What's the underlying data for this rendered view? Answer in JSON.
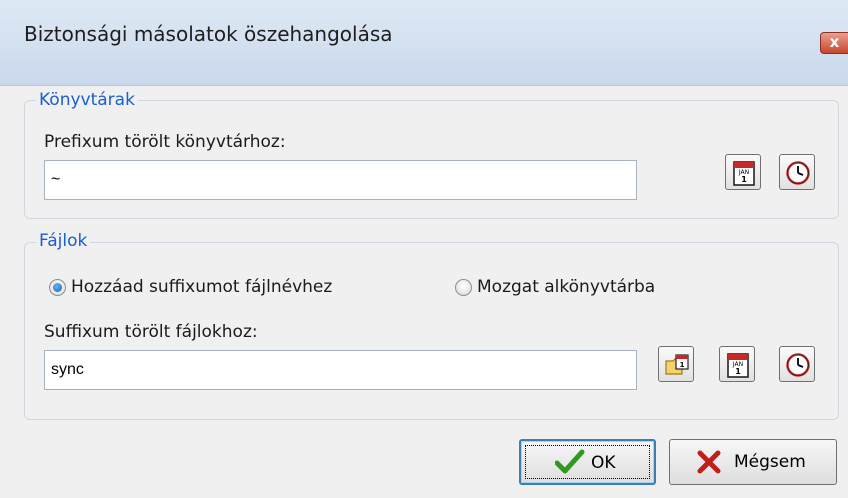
{
  "window": {
    "title": "Biztonsági másolatok öszehangolása",
    "close_label": "x"
  },
  "libraries": {
    "legend": "Könyvtárak",
    "prefix_label": "Prefixum törölt könyvtárhoz:",
    "prefix_value": "~",
    "calendar_icon": "calendar-icon",
    "clock_icon": "clock-icon"
  },
  "files": {
    "legend": "Fájlok",
    "options": [
      {
        "label": "Hozzáad suffixumot fájlnévhez",
        "selected": true
      },
      {
        "label": "Mozgat alkönyvtárba",
        "selected": false
      }
    ],
    "suffix_label": "Suffixum törölt fájlokhoz:",
    "suffix_value": "sync",
    "folder_icon": "folder-calendar-icon",
    "calendar_icon": "calendar-icon",
    "clock_icon": "clock-icon"
  },
  "buttons": {
    "ok_label": "OK",
    "cancel_label": "Mégsem"
  },
  "colors": {
    "accent": "#1b5fcd",
    "ok_check": "#2f9a1e",
    "cancel_x": "#c0201a"
  }
}
